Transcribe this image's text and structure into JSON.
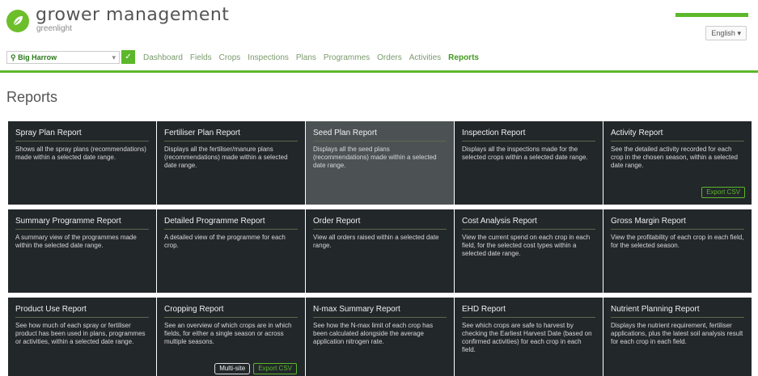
{
  "brand": {
    "name": "grower management",
    "sub": "greenlight"
  },
  "language": "English",
  "farm": {
    "value": "Big Harrow"
  },
  "nav": {
    "items": [
      "Dashboard",
      "Fields",
      "Crops",
      "Inspections",
      "Plans",
      "Programmes",
      "Orders",
      "Activities",
      "Reports"
    ],
    "active": "Reports"
  },
  "page": {
    "title": "Reports"
  },
  "cards": [
    {
      "title": "Spray Plan Report",
      "desc": "Shows all the spray plans (recommendations) made within a selected date range."
    },
    {
      "title": "Fertiliser Plan Report",
      "desc": "Displays all the fertiliser/manure plans (recommendations) made within a selected date range."
    },
    {
      "title": "Seed Plan Report",
      "desc": "Displays all the seed plans (recommendations) made within a selected date range."
    },
    {
      "title": "Inspection Report",
      "desc": "Displays all the inspections made for the selected crops within a selected date range."
    },
    {
      "title": "Activity Report",
      "desc": "See the detailed activity recorded for each crop in the chosen season, within a selected date range.",
      "export": "Export CSV"
    },
    {
      "title": "Summary Programme Report",
      "desc": "A summary view of the programmes made within the selected date range."
    },
    {
      "title": "Detailed Programme Report",
      "desc": "A detailed view of the programme for each crop."
    },
    {
      "title": "Order Report",
      "desc": "View all orders raised within a selected date range."
    },
    {
      "title": "Cost Analysis Report",
      "desc": "View the current spend on each crop in each field, for the selected cost types within a selected date range."
    },
    {
      "title": "Gross Margin Report",
      "desc": "View the profitability of each crop in each field, for the selected season."
    },
    {
      "title": "Product Use Report",
      "desc": "See how much of each spray or fertiliser product has been used in plans, programmes or activities, within a selected date range."
    },
    {
      "title": "Cropping Report",
      "desc": "See an overview of which crops are in which fields, for either a single season or across multiple seasons.",
      "multi": "Multi-site",
      "export": "Export CSV"
    },
    {
      "title": "N-max Summary Report",
      "desc": "See how the N-max limit of each crop has been calculated alongside the average application nitrogen rate."
    },
    {
      "title": "EHD Report",
      "desc": "See which crops are safe to harvest by checking the Earliest Harvest Date (based on confirmed activities) for each crop in each field."
    },
    {
      "title": "Nutrient Planning Report",
      "desc": "Displays the nutrient requirement, fertiliser applications, plus the latest soil analysis result for each crop in each field."
    }
  ],
  "colors": {
    "accent": "#5cb82a",
    "card_bg": "#22272a",
    "card_highlight": "#4c5254"
  },
  "icons": {
    "logo": "leaf-icon",
    "search": "search-icon",
    "caret": "chevron-down-icon"
  }
}
